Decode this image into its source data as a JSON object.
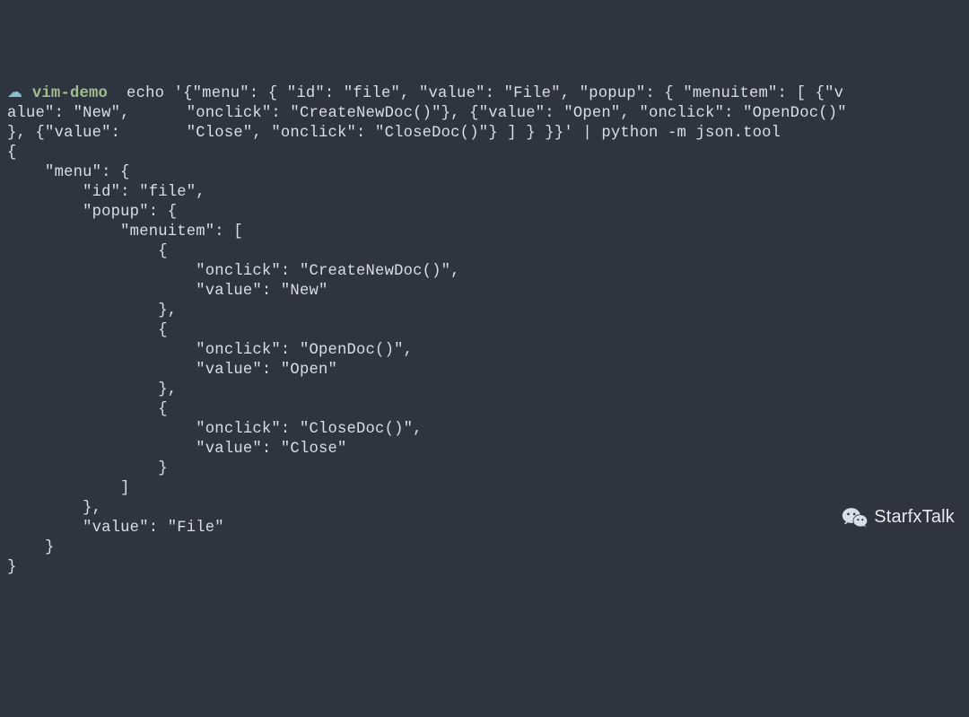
{
  "prompt": {
    "icon_glyph": "☁",
    "host": "vim-demo",
    "command_segments": [
      " echo '{\"menu\": { \"id\": \"file\", \"value\": \"File\", \"popup\": { \"menuitem\": [ {\"v",
      "alue\": \"New\",      \"onclick\": \"CreateNewDoc()\"}, {\"value\": \"Open\", \"onclick\": \"OpenDoc()\"",
      "}, {\"value\":       \"Close\", \"onclick\": \"CloseDoc()\"} ] } }}' | python -m json.tool"
    ]
  },
  "output_lines": [
    "{",
    "    \"menu\": {",
    "        \"id\": \"file\",",
    "        \"popup\": {",
    "            \"menuitem\": [",
    "                {",
    "                    \"onclick\": \"CreateNewDoc()\",",
    "                    \"value\": \"New\"",
    "                },",
    "                {",
    "                    \"onclick\": \"OpenDoc()\",",
    "                    \"value\": \"Open\"",
    "                },",
    "                {",
    "                    \"onclick\": \"CloseDoc()\",",
    "                    \"value\": \"Close\"",
    "                }",
    "            ]",
    "        },",
    "        \"value\": \"File\"",
    "    }",
    "}"
  ],
  "watermark": {
    "text": "StarfxTalk"
  }
}
